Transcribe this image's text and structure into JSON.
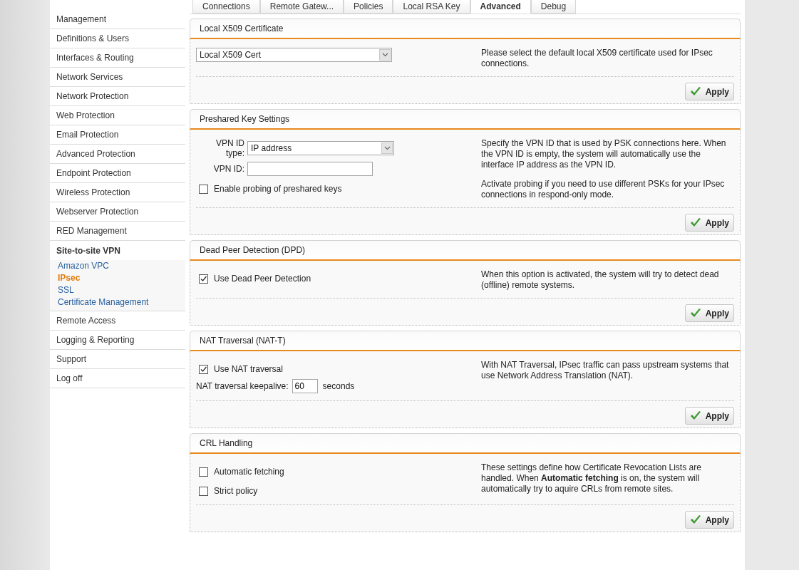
{
  "sidebar": {
    "items": [
      {
        "label": "Management",
        "kind": "item",
        "selected": false
      },
      {
        "label": "Definitions & Users",
        "kind": "item",
        "selected": false
      },
      {
        "label": "Interfaces & Routing",
        "kind": "item",
        "selected": false
      },
      {
        "label": "Network Services",
        "kind": "item",
        "selected": false
      },
      {
        "label": "Network Protection",
        "kind": "item",
        "selected": false
      },
      {
        "label": "Web Protection",
        "kind": "item",
        "selected": false
      },
      {
        "label": "Email Protection",
        "kind": "item",
        "selected": false
      },
      {
        "label": "Advanced Protection",
        "kind": "item",
        "selected": false
      },
      {
        "label": "Endpoint Protection",
        "kind": "item",
        "selected": false
      },
      {
        "label": "Wireless Protection",
        "kind": "item",
        "selected": false
      },
      {
        "label": "Webserver Protection",
        "kind": "item",
        "selected": false
      },
      {
        "label": "RED Management",
        "kind": "item",
        "selected": false
      },
      {
        "label": "Site-to-site VPN",
        "kind": "group",
        "selected": false,
        "children": [
          {
            "label": "Amazon VPC",
            "selected": false
          },
          {
            "label": "IPsec",
            "selected": true
          },
          {
            "label": "SSL",
            "selected": false
          },
          {
            "label": "Certificate Management",
            "selected": false
          }
        ]
      },
      {
        "label": "Remote Access",
        "kind": "item",
        "selected": false
      },
      {
        "label": "Logging & Reporting",
        "kind": "item",
        "selected": false
      },
      {
        "label": "Support",
        "kind": "item",
        "selected": false
      },
      {
        "label": "Log off",
        "kind": "item",
        "selected": false
      }
    ]
  },
  "tabs": [
    {
      "label": "Connections",
      "selected": false
    },
    {
      "label": "Remote Gatew...",
      "selected": false
    },
    {
      "label": "Policies",
      "selected": false
    },
    {
      "label": "Local RSA Key",
      "selected": false
    },
    {
      "label": "Advanced",
      "selected": true
    },
    {
      "label": "Debug",
      "selected": false
    }
  ],
  "sections": [
    {
      "title": "Local X509 Certificate",
      "fields": [
        {
          "kind": "select",
          "value": "Local X509 Cert"
        }
      ],
      "description": [
        "Please select the default local X509 certificate used for IPsec connections."
      ],
      "apply": "Apply"
    },
    {
      "title": "Preshared Key Settings",
      "fields": [
        {
          "kind": "select",
          "label": "VPN ID type:",
          "value": "IP address"
        },
        {
          "kind": "text",
          "label": "VPN ID:"
        },
        {
          "kind": "checkbox",
          "label": "Enable probing of preshared keys",
          "checked": false
        }
      ],
      "description": [
        "Specify the VPN ID that is used by PSK connections here. When the VPN ID is empty, the system will automatically use the interface IP address as the VPN ID.",
        "Activate probing if you need to use different PSKs for your IPsec connections in respond-only mode."
      ],
      "apply": "Apply"
    },
    {
      "title": "Dead Peer Detection (DPD)",
      "fields": [
        {
          "kind": "checkbox",
          "label": "Use Dead Peer Detection",
          "checked": true
        }
      ],
      "description": [
        "When this option is activated, the system will try to detect dead (offline) remote systems."
      ],
      "apply": "Apply"
    },
    {
      "title": "NAT Traversal (NAT-T)",
      "fields": [
        {
          "kind": "checkbox",
          "label": "Use NAT traversal",
          "checked": true
        },
        {
          "kind": "number",
          "label": "NAT traversal keepalive:",
          "value": "60",
          "unit": "seconds"
        }
      ],
      "description": [
        "With NAT Traversal, IPsec traffic can pass upstream systems that use Network Address Translation (NAT)."
      ],
      "apply": "Apply"
    },
    {
      "title": "CRL Handling",
      "fields": [
        {
          "kind": "checkbox",
          "label": "Automatic fetching",
          "checked": false
        },
        {
          "kind": "checkbox",
          "label": "Strict policy",
          "checked": false
        }
      ],
      "description": [
        "These settings define how Certificate Revocation Lists are handled. When **Automatic fetching** is on, the system will automatically try to aquire CRLs from remote sites."
      ],
      "apply": "Apply"
    }
  ]
}
